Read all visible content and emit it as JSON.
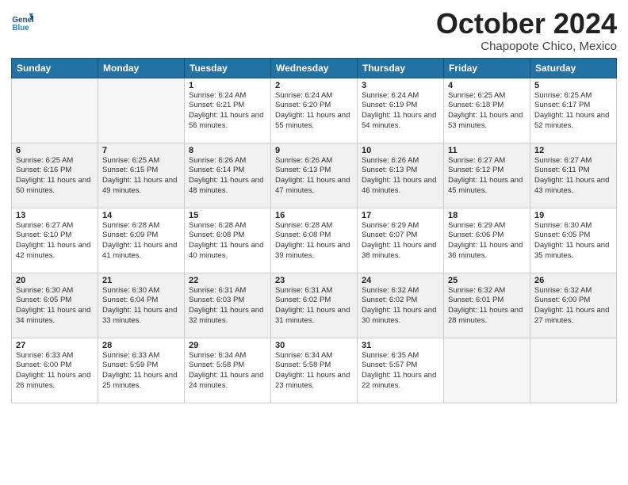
{
  "logo": {
    "text1": "General",
    "text2": "Blue"
  },
  "title": "October 2024",
  "subtitle": "Chapopote Chico, Mexico",
  "days_of_week": [
    "Sunday",
    "Monday",
    "Tuesday",
    "Wednesday",
    "Thursday",
    "Friday",
    "Saturday"
  ],
  "weeks": [
    [
      {
        "day": "",
        "sunrise": "",
        "sunset": "",
        "daylight": "",
        "empty": true
      },
      {
        "day": "",
        "sunrise": "",
        "sunset": "",
        "daylight": "",
        "empty": true
      },
      {
        "day": "1",
        "sunrise": "Sunrise: 6:24 AM",
        "sunset": "Sunset: 6:21 PM",
        "daylight": "Daylight: 11 hours and 56 minutes."
      },
      {
        "day": "2",
        "sunrise": "Sunrise: 6:24 AM",
        "sunset": "Sunset: 6:20 PM",
        "daylight": "Daylight: 11 hours and 55 minutes."
      },
      {
        "day": "3",
        "sunrise": "Sunrise: 6:24 AM",
        "sunset": "Sunset: 6:19 PM",
        "daylight": "Daylight: 11 hours and 54 minutes."
      },
      {
        "day": "4",
        "sunrise": "Sunrise: 6:25 AM",
        "sunset": "Sunset: 6:18 PM",
        "daylight": "Daylight: 11 hours and 53 minutes."
      },
      {
        "day": "5",
        "sunrise": "Sunrise: 6:25 AM",
        "sunset": "Sunset: 6:17 PM",
        "daylight": "Daylight: 11 hours and 52 minutes."
      }
    ],
    [
      {
        "day": "6",
        "sunrise": "Sunrise: 6:25 AM",
        "sunset": "Sunset: 6:16 PM",
        "daylight": "Daylight: 11 hours and 50 minutes."
      },
      {
        "day": "7",
        "sunrise": "Sunrise: 6:25 AM",
        "sunset": "Sunset: 6:15 PM",
        "daylight": "Daylight: 11 hours and 49 minutes."
      },
      {
        "day": "8",
        "sunrise": "Sunrise: 6:26 AM",
        "sunset": "Sunset: 6:14 PM",
        "daylight": "Daylight: 11 hours and 48 minutes."
      },
      {
        "day": "9",
        "sunrise": "Sunrise: 6:26 AM",
        "sunset": "Sunset: 6:13 PM",
        "daylight": "Daylight: 11 hours and 47 minutes."
      },
      {
        "day": "10",
        "sunrise": "Sunrise: 6:26 AM",
        "sunset": "Sunset: 6:13 PM",
        "daylight": "Daylight: 11 hours and 46 minutes."
      },
      {
        "day": "11",
        "sunrise": "Sunrise: 6:27 AM",
        "sunset": "Sunset: 6:12 PM",
        "daylight": "Daylight: 11 hours and 45 minutes."
      },
      {
        "day": "12",
        "sunrise": "Sunrise: 6:27 AM",
        "sunset": "Sunset: 6:11 PM",
        "daylight": "Daylight: 11 hours and 43 minutes."
      }
    ],
    [
      {
        "day": "13",
        "sunrise": "Sunrise: 6:27 AM",
        "sunset": "Sunset: 6:10 PM",
        "daylight": "Daylight: 11 hours and 42 minutes."
      },
      {
        "day": "14",
        "sunrise": "Sunrise: 6:28 AM",
        "sunset": "Sunset: 6:09 PM",
        "daylight": "Daylight: 11 hours and 41 minutes."
      },
      {
        "day": "15",
        "sunrise": "Sunrise: 6:28 AM",
        "sunset": "Sunset: 6:08 PM",
        "daylight": "Daylight: 11 hours and 40 minutes."
      },
      {
        "day": "16",
        "sunrise": "Sunrise: 6:28 AM",
        "sunset": "Sunset: 6:08 PM",
        "daylight": "Daylight: 11 hours and 39 minutes."
      },
      {
        "day": "17",
        "sunrise": "Sunrise: 6:29 AM",
        "sunset": "Sunset: 6:07 PM",
        "daylight": "Daylight: 11 hours and 38 minutes."
      },
      {
        "day": "18",
        "sunrise": "Sunrise: 6:29 AM",
        "sunset": "Sunset: 6:06 PM",
        "daylight": "Daylight: 11 hours and 36 minutes."
      },
      {
        "day": "19",
        "sunrise": "Sunrise: 6:30 AM",
        "sunset": "Sunset: 6:05 PM",
        "daylight": "Daylight: 11 hours and 35 minutes."
      }
    ],
    [
      {
        "day": "20",
        "sunrise": "Sunrise: 6:30 AM",
        "sunset": "Sunset: 6:05 PM",
        "daylight": "Daylight: 11 hours and 34 minutes."
      },
      {
        "day": "21",
        "sunrise": "Sunrise: 6:30 AM",
        "sunset": "Sunset: 6:04 PM",
        "daylight": "Daylight: 11 hours and 33 minutes."
      },
      {
        "day": "22",
        "sunrise": "Sunrise: 6:31 AM",
        "sunset": "Sunset: 6:03 PM",
        "daylight": "Daylight: 11 hours and 32 minutes."
      },
      {
        "day": "23",
        "sunrise": "Sunrise: 6:31 AM",
        "sunset": "Sunset: 6:02 PM",
        "daylight": "Daylight: 11 hours and 31 minutes."
      },
      {
        "day": "24",
        "sunrise": "Sunrise: 6:32 AM",
        "sunset": "Sunset: 6:02 PM",
        "daylight": "Daylight: 11 hours and 30 minutes."
      },
      {
        "day": "25",
        "sunrise": "Sunrise: 6:32 AM",
        "sunset": "Sunset: 6:01 PM",
        "daylight": "Daylight: 11 hours and 28 minutes."
      },
      {
        "day": "26",
        "sunrise": "Sunrise: 6:32 AM",
        "sunset": "Sunset: 6:00 PM",
        "daylight": "Daylight: 11 hours and 27 minutes."
      }
    ],
    [
      {
        "day": "27",
        "sunrise": "Sunrise: 6:33 AM",
        "sunset": "Sunset: 6:00 PM",
        "daylight": "Daylight: 11 hours and 26 minutes."
      },
      {
        "day": "28",
        "sunrise": "Sunrise: 6:33 AM",
        "sunset": "Sunset: 5:59 PM",
        "daylight": "Daylight: 11 hours and 25 minutes."
      },
      {
        "day": "29",
        "sunrise": "Sunrise: 6:34 AM",
        "sunset": "Sunset: 5:58 PM",
        "daylight": "Daylight: 11 hours and 24 minutes."
      },
      {
        "day": "30",
        "sunrise": "Sunrise: 6:34 AM",
        "sunset": "Sunset: 5:58 PM",
        "daylight": "Daylight: 11 hours and 23 minutes."
      },
      {
        "day": "31",
        "sunrise": "Sunrise: 6:35 AM",
        "sunset": "Sunset: 5:57 PM",
        "daylight": "Daylight: 11 hours and 22 minutes."
      },
      {
        "day": "",
        "sunrise": "",
        "sunset": "",
        "daylight": "",
        "empty": true
      },
      {
        "day": "",
        "sunrise": "",
        "sunset": "",
        "daylight": "",
        "empty": true
      }
    ]
  ]
}
